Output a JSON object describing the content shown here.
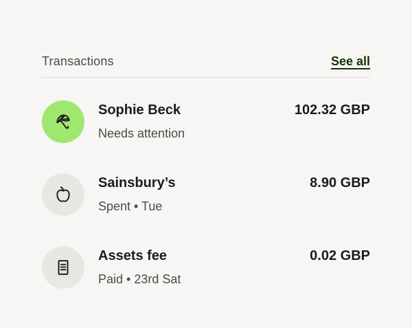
{
  "section": {
    "title": "Transactions",
    "see_all_label": "See all"
  },
  "transactions": [
    {
      "name": "Sophie Beck",
      "subtitle": "Needs attention",
      "amount": "102.32 GBP",
      "icon": "umbrella-icon"
    },
    {
      "name": "Sainsbury’s",
      "subtitle": "Spent • Tue",
      "amount": "8.90 GBP",
      "icon": "apple-icon"
    },
    {
      "name": "Assets fee",
      "subtitle": "Paid • 23rd Sat",
      "amount": "0.02 GBP",
      "icon": "receipt-icon"
    }
  ],
  "colors": {
    "background": "#f7f6f4",
    "attention_accent": "#9fe870",
    "neutral_icon_bg": "#e8e8e3",
    "link": "#163300"
  }
}
